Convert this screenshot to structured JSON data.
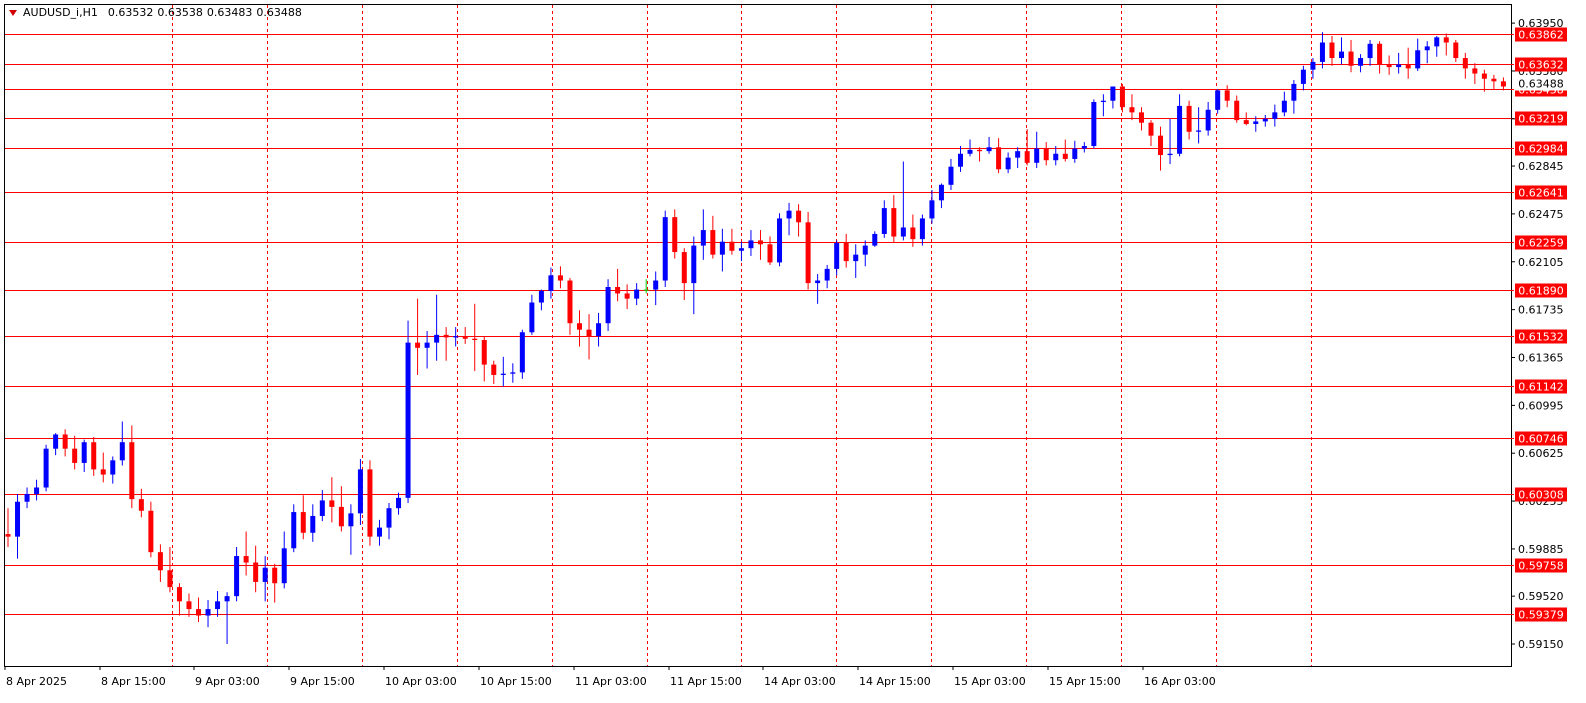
{
  "header": {
    "symbol": "AUDUSD_i,H1",
    "open": "0.63532",
    "high": "0.63538",
    "low": "0.63483",
    "close": "0.63488"
  },
  "colors": {
    "background": "#ffffff",
    "bull_candle": "#0000ff",
    "bear_candle": "#ff0000",
    "doji_candle": "#00cc00",
    "horizontal_lines": "#ff0000",
    "vertical_separators": "#ff0000",
    "axis_text": "#000000"
  },
  "chart_data": {
    "type": "candlestick",
    "timeframe": "H1",
    "ylim": [
      0.5898,
      0.6409
    ],
    "y_ticks": [
      "0.63950",
      "0.63580",
      "0.63210",
      "0.62845",
      "0.62475",
      "0.62105",
      "0.61735",
      "0.61365",
      "0.60995",
      "0.60625",
      "0.60255",
      "0.59885",
      "0.59520",
      "0.59150"
    ],
    "x_ticks": [
      "8 Apr 2025",
      "8 Apr 15:00",
      "9 Apr 03:00",
      "9 Apr 15:00",
      "10 Apr 03:00",
      "10 Apr 15:00",
      "11 Apr 03:00",
      "11 Apr 15:00",
      "14 Apr 03:00",
      "14 Apr 15:00",
      "15 Apr 03:00",
      "15 Apr 15:00",
      "16 Apr 03:00"
    ],
    "horizontal_levels": [
      "0.63862",
      "0.63632",
      "0.63438",
      "0.63219",
      "0.62984",
      "0.62641",
      "0.62259",
      "0.61890",
      "0.61532",
      "0.61142",
      "0.60746",
      "0.60308",
      "0.59758",
      "0.59379"
    ],
    "current_price_tag": "0.63488",
    "grid": "vertical dashed at every 12 bars",
    "candles_ohlc": [
      [
        0.6,
        0.602,
        0.599,
        0.5998
      ],
      [
        0.5998,
        0.6031,
        0.5981,
        0.6025
      ],
      [
        0.6025,
        0.6036,
        0.602,
        0.6031
      ],
      [
        0.6031,
        0.6042,
        0.6026,
        0.6036
      ],
      [
        0.6036,
        0.6069,
        0.6033,
        0.6066
      ],
      [
        0.6066,
        0.6078,
        0.6061,
        0.6077
      ],
      [
        0.6077,
        0.6081,
        0.606,
        0.6066
      ],
      [
        0.6066,
        0.6076,
        0.605,
        0.6055
      ],
      [
        0.6055,
        0.6073,
        0.6048,
        0.6071
      ],
      [
        0.6071,
        0.6075,
        0.6045,
        0.605
      ],
      [
        0.605,
        0.6063,
        0.604,
        0.6046
      ],
      [
        0.6046,
        0.606,
        0.6039,
        0.6057
      ],
      [
        0.6057,
        0.6087,
        0.6053,
        0.6071
      ],
      [
        0.6071,
        0.6084,
        0.602,
        0.6027
      ],
      [
        0.6027,
        0.6035,
        0.6013,
        0.6018
      ],
      [
        0.6018,
        0.6025,
        0.5982,
        0.5986
      ],
      [
        0.5986,
        0.5992,
        0.5963,
        0.5972
      ],
      [
        0.5972,
        0.599,
        0.5955,
        0.5959
      ],
      [
        0.5959,
        0.5962,
        0.5937,
        0.5948
      ],
      [
        0.5948,
        0.5954,
        0.5936,
        0.5942
      ],
      [
        0.5942,
        0.5951,
        0.5932,
        0.5937
      ],
      [
        0.5937,
        0.5949,
        0.5928,
        0.5942
      ],
      [
        0.5942,
        0.5956,
        0.5936,
        0.5948
      ],
      [
        0.5948,
        0.5955,
        0.5915,
        0.5952
      ],
      [
        0.5952,
        0.599,
        0.5948,
        0.5983
      ],
      [
        0.5983,
        0.6002,
        0.5968,
        0.5978
      ],
      [
        0.5978,
        0.5991,
        0.5955,
        0.5963
      ],
      [
        0.5963,
        0.5983,
        0.5948,
        0.5974
      ],
      [
        0.5974,
        0.5977,
        0.5947,
        0.5962
      ],
      [
        0.5962,
        0.6002,
        0.5958,
        0.5989
      ],
      [
        0.5989,
        0.6023,
        0.5986,
        0.6017
      ],
      [
        0.6017,
        0.603,
        0.5996,
        0.6001
      ],
      [
        0.6001,
        0.6023,
        0.5994,
        0.6014
      ],
      [
        0.6014,
        0.6034,
        0.601,
        0.6026
      ],
      [
        0.6026,
        0.6044,
        0.6009,
        0.6021
      ],
      [
        0.6021,
        0.6037,
        0.6002,
        0.6006
      ],
      [
        0.6006,
        0.6023,
        0.5984,
        0.6016
      ],
      [
        0.6016,
        0.6058,
        0.6007,
        0.605
      ],
      [
        0.605,
        0.6057,
        0.5991,
        0.5998
      ],
      [
        0.5998,
        0.6011,
        0.5991,
        0.6005
      ],
      [
        0.6005,
        0.6024,
        0.5996,
        0.602
      ],
      [
        0.602,
        0.6032,
        0.6015,
        0.6028
      ],
      [
        0.6028,
        0.6165,
        0.6024,
        0.6148
      ],
      [
        0.6148,
        0.6182,
        0.6123,
        0.6144
      ],
      [
        0.6144,
        0.6157,
        0.6128,
        0.6148
      ],
      [
        0.6148,
        0.6185,
        0.6134,
        0.6154
      ],
      [
        0.6154,
        0.616,
        0.6134,
        0.6152
      ],
      [
        0.6152,
        0.616,
        0.6145,
        0.6153
      ],
      [
        0.6153,
        0.616,
        0.6147,
        0.6151
      ],
      [
        0.6151,
        0.6178,
        0.6126,
        0.615
      ],
      [
        0.615,
        0.6153,
        0.6118,
        0.6131
      ],
      [
        0.6131,
        0.6134,
        0.6116,
        0.6123
      ],
      [
        0.6123,
        0.6137,
        0.6114,
        0.6124
      ],
      [
        0.6124,
        0.6132,
        0.6117,
        0.6125
      ],
      [
        0.6125,
        0.6158,
        0.612,
        0.6156
      ],
      [
        0.6156,
        0.6185,
        0.6154,
        0.6179
      ],
      [
        0.6179,
        0.6189,
        0.6173,
        0.6188
      ],
      [
        0.6188,
        0.6206,
        0.6182,
        0.62
      ],
      [
        0.62,
        0.6207,
        0.619,
        0.6196
      ],
      [
        0.6196,
        0.6198,
        0.6154,
        0.6163
      ],
      [
        0.6163,
        0.6173,
        0.6145,
        0.6158
      ],
      [
        0.6158,
        0.617,
        0.6135,
        0.6153
      ],
      [
        0.6153,
        0.6171,
        0.6145,
        0.6163
      ],
      [
        0.6163,
        0.6197,
        0.6157,
        0.6191
      ],
      [
        0.6191,
        0.6205,
        0.618,
        0.6186
      ],
      [
        0.6186,
        0.6193,
        0.6174,
        0.6182
      ],
      [
        0.6182,
        0.6194,
        0.6177,
        0.6189
      ],
      [
        0.6189,
        0.6197,
        0.6186,
        0.6189
      ],
      [
        0.6189,
        0.6203,
        0.6177,
        0.6196
      ],
      [
        0.6196,
        0.625,
        0.6191,
        0.6245
      ],
      [
        0.6245,
        0.6251,
        0.6213,
        0.6218
      ],
      [
        0.6218,
        0.6221,
        0.6181,
        0.6194
      ],
      [
        0.6194,
        0.623,
        0.617,
        0.6223
      ],
      [
        0.6223,
        0.6251,
        0.6212,
        0.6235
      ],
      [
        0.6235,
        0.6246,
        0.6213,
        0.6216
      ],
      [
        0.6216,
        0.6236,
        0.6203,
        0.6226
      ],
      [
        0.6226,
        0.6236,
        0.6216,
        0.6219
      ],
      [
        0.6219,
        0.6226,
        0.6211,
        0.6221
      ],
      [
        0.6221,
        0.6235,
        0.6215,
        0.6227
      ],
      [
        0.6227,
        0.6235,
        0.6212,
        0.6224
      ],
      [
        0.6224,
        0.623,
        0.6208,
        0.621
      ],
      [
        0.621,
        0.6248,
        0.6207,
        0.6244
      ],
      [
        0.6244,
        0.6256,
        0.6231,
        0.625
      ],
      [
        0.625,
        0.6255,
        0.623,
        0.6241
      ],
      [
        0.6241,
        0.6249,
        0.6189,
        0.6194
      ],
      [
        0.6194,
        0.6201,
        0.6178,
        0.6196
      ],
      [
        0.6196,
        0.6208,
        0.619,
        0.6205
      ],
      [
        0.6205,
        0.6227,
        0.62,
        0.6225
      ],
      [
        0.6225,
        0.6232,
        0.6206,
        0.6211
      ],
      [
        0.6211,
        0.6224,
        0.6198,
        0.6216
      ],
      [
        0.6216,
        0.6227,
        0.6207,
        0.6223
      ],
      [
        0.6223,
        0.6234,
        0.6222,
        0.6232
      ],
      [
        0.6232,
        0.6258,
        0.6229,
        0.6252
      ],
      [
        0.6252,
        0.6262,
        0.6225,
        0.623
      ],
      [
        0.623,
        0.6288,
        0.6227,
        0.6237
      ],
      [
        0.6237,
        0.6247,
        0.6222,
        0.6228
      ],
      [
        0.6228,
        0.6247,
        0.6223,
        0.6244
      ],
      [
        0.6244,
        0.6266,
        0.624,
        0.6258
      ],
      [
        0.6258,
        0.6271,
        0.6252,
        0.627
      ],
      [
        0.627,
        0.629,
        0.6266,
        0.6284
      ],
      [
        0.6284,
        0.63,
        0.628,
        0.6294
      ],
      [
        0.6294,
        0.6305,
        0.6292,
        0.6297
      ],
      [
        0.6297,
        0.6299,
        0.6288,
        0.6296
      ],
      [
        0.6296,
        0.6307,
        0.6294,
        0.6299
      ],
      [
        0.6299,
        0.6306,
        0.6279,
        0.6282
      ],
      [
        0.6282,
        0.6295,
        0.6279,
        0.6291
      ],
      [
        0.6291,
        0.6299,
        0.6283,
        0.6296
      ],
      [
        0.6296,
        0.6313,
        0.6285,
        0.6287
      ],
      [
        0.6287,
        0.6311,
        0.6283,
        0.6298
      ],
      [
        0.6298,
        0.6303,
        0.6285,
        0.6289
      ],
      [
        0.6289,
        0.63,
        0.6285,
        0.6294
      ],
      [
        0.6294,
        0.6305,
        0.6288,
        0.629
      ],
      [
        0.629,
        0.6304,
        0.6287,
        0.6298
      ],
      [
        0.6298,
        0.6303,
        0.6295,
        0.63
      ],
      [
        0.63,
        0.6336,
        0.6298,
        0.6334
      ],
      [
        0.6334,
        0.634,
        0.6323,
        0.6335
      ],
      [
        0.6335,
        0.6346,
        0.6329,
        0.6346
      ],
      [
        0.6346,
        0.6348,
        0.6326,
        0.633
      ],
      [
        0.633,
        0.634,
        0.632,
        0.6326
      ],
      [
        0.6326,
        0.633,
        0.6312,
        0.6318
      ],
      [
        0.6318,
        0.632,
        0.63,
        0.6308
      ],
      [
        0.6308,
        0.6315,
        0.6281,
        0.6293
      ],
      [
        0.6293,
        0.6321,
        0.6286,
        0.6294
      ],
      [
        0.6294,
        0.634,
        0.6292,
        0.6331
      ],
      [
        0.6331,
        0.6335,
        0.6305,
        0.6311
      ],
      [
        0.6311,
        0.633,
        0.6302,
        0.6312
      ],
      [
        0.6312,
        0.6334,
        0.6308,
        0.6328
      ],
      [
        0.6328,
        0.6344,
        0.6325,
        0.6343
      ],
      [
        0.6343,
        0.6347,
        0.633,
        0.6335
      ],
      [
        0.6335,
        0.6339,
        0.6318,
        0.632
      ],
      [
        0.632,
        0.6326,
        0.6316,
        0.6317
      ],
      [
        0.6317,
        0.6323,
        0.6311,
        0.6319
      ],
      [
        0.6319,
        0.6324,
        0.6315,
        0.6321
      ],
      [
        0.6321,
        0.6332,
        0.6315,
        0.6326
      ],
      [
        0.6326,
        0.6342,
        0.6323,
        0.6335
      ],
      [
        0.6335,
        0.6351,
        0.6325,
        0.6348
      ],
      [
        0.6348,
        0.6362,
        0.6343,
        0.6359
      ],
      [
        0.6359,
        0.6368,
        0.6352,
        0.6365
      ],
      [
        0.6365,
        0.6388,
        0.636,
        0.638
      ],
      [
        0.638,
        0.6385,
        0.6362,
        0.6368
      ],
      [
        0.6368,
        0.6384,
        0.6363,
        0.6373
      ],
      [
        0.6373,
        0.6382,
        0.6357,
        0.6362
      ],
      [
        0.6362,
        0.6371,
        0.6357,
        0.6368
      ],
      [
        0.6368,
        0.6382,
        0.6362,
        0.6379
      ],
      [
        0.6379,
        0.6381,
        0.6356,
        0.6363
      ],
      [
        0.6363,
        0.637,
        0.6355,
        0.6361
      ],
      [
        0.6361,
        0.6372,
        0.6356,
        0.6363
      ],
      [
        0.6363,
        0.6376,
        0.6352,
        0.636
      ],
      [
        0.636,
        0.6383,
        0.6358,
        0.6374
      ],
      [
        0.6374,
        0.6381,
        0.6364,
        0.6377
      ],
      [
        0.6377,
        0.6385,
        0.6369,
        0.6384
      ],
      [
        0.6384,
        0.6387,
        0.637,
        0.638
      ],
      [
        0.638,
        0.6382,
        0.6365,
        0.6368
      ],
      [
        0.6368,
        0.6372,
        0.6352,
        0.636
      ],
      [
        0.636,
        0.6364,
        0.6348,
        0.6356
      ],
      [
        0.6356,
        0.6359,
        0.6342,
        0.6352
      ],
      [
        0.6352,
        0.6355,
        0.6344,
        0.635
      ],
      [
        0.635,
        0.6353,
        0.6343,
        0.6346
      ],
      [
        0.6346,
        0.6352,
        0.6337,
        0.6349
      ],
      [
        0.6349,
        0.6351,
        0.6336,
        0.6344
      ],
      [
        0.6344,
        0.6353,
        0.6334,
        0.634
      ],
      [
        0.634,
        0.6346,
        0.632,
        0.6331
      ],
      [
        0.6331,
        0.6348,
        0.6325,
        0.634
      ],
      [
        0.634,
        0.6345,
        0.6322,
        0.6338
      ],
      [
        0.6338,
        0.6342,
        0.6328,
        0.6333
      ],
      [
        0.6333,
        0.6345,
        0.6324,
        0.6344
      ],
      [
        0.6344,
        0.6351,
        0.6336,
        0.6342
      ],
      [
        0.6342,
        0.6356,
        0.6336,
        0.634
      ],
      [
        0.634,
        0.6349,
        0.6338,
        0.6347
      ],
      [
        0.6347,
        0.6355,
        0.6343,
        0.6353
      ],
      [
        0.6353,
        0.6356,
        0.6343,
        0.6348
      ],
      [
        0.6353,
        0.6354,
        0.6348,
        0.6349
      ]
    ]
  }
}
